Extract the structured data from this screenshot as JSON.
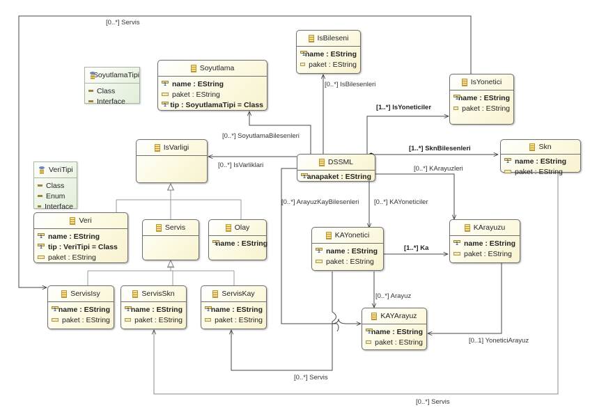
{
  "diagram": {
    "type": "Ecore class diagram",
    "classes": {
      "soyutlama": {
        "name": "Soyutlama",
        "attrs": [
          {
            "text": "name : EString",
            "key": true
          },
          {
            "text": "paket : EString",
            "key": false
          },
          {
            "text": "tip : SoyutlamaTipi = Class",
            "key": true
          }
        ]
      },
      "isbileseni": {
        "name": "IsBileseni",
        "attrs": [
          {
            "text": "name : EString",
            "key": true
          },
          {
            "text": "paket : EString",
            "key": false
          }
        ]
      },
      "isyonetici": {
        "name": "IsYonetici",
        "attrs": [
          {
            "text": "name : EString",
            "key": true
          },
          {
            "text": "paket : EString",
            "key": false
          }
        ]
      },
      "isvarligi": {
        "name": "IsVarligi",
        "attrs": []
      },
      "dssml": {
        "name": "DSSML",
        "attrs": [
          {
            "text": "anapaket : EString",
            "key": true
          }
        ]
      },
      "skn": {
        "name": "Skn",
        "attrs": [
          {
            "text": "name : EString",
            "key": true
          },
          {
            "text": "paket : EString",
            "key": false
          }
        ]
      },
      "veri": {
        "name": "Veri",
        "attrs": [
          {
            "text": "name : EString",
            "key": true
          },
          {
            "text": "tip : VeriTipi = Class",
            "key": true
          },
          {
            "text": "paket : EString",
            "key": false
          }
        ]
      },
      "servis": {
        "name": "Servis",
        "attrs": []
      },
      "olay": {
        "name": "Olay",
        "attrs": [
          {
            "text": "name : EString",
            "key": true
          }
        ]
      },
      "kayonetici": {
        "name": "KAYonetici",
        "attrs": [
          {
            "text": "name : EString",
            "key": true
          },
          {
            "text": "paket : EString",
            "key": false
          }
        ]
      },
      "karayuzu": {
        "name": "KArayuzu",
        "attrs": [
          {
            "text": "name : EString",
            "key": true
          },
          {
            "text": "paket : EString",
            "key": false
          }
        ]
      },
      "servisisy": {
        "name": "ServisIsy",
        "attrs": [
          {
            "text": "name : EString",
            "key": true
          },
          {
            "text": "paket : EString",
            "key": false
          }
        ]
      },
      "servisskn": {
        "name": "ServisSkn",
        "attrs": [
          {
            "text": "name : EString",
            "key": true
          },
          {
            "text": "paket : EString",
            "key": false
          }
        ]
      },
      "serviskay": {
        "name": "ServisKay",
        "attrs": [
          {
            "text": "name : EString",
            "key": true
          },
          {
            "text": "paket : EString",
            "key": false
          }
        ]
      },
      "kayarayuz": {
        "name": "KAYArayuz",
        "attrs": [
          {
            "text": "name : EString",
            "key": true
          },
          {
            "text": "paket : EString",
            "key": false
          }
        ]
      }
    },
    "enums": {
      "soyutlamatipi": {
        "name": "SoyutlamaTipi",
        "literals": [
          "Class",
          "Interface"
        ]
      },
      "veritipi": {
        "name": "VeriTipi",
        "literals": [
          "Class",
          "Enum",
          "Interface"
        ]
      }
    },
    "references": {
      "servis_top": "[0..*] Servis",
      "isbilesenleri": "[0..*] IsBilesenleri",
      "soyutlamabilesenleri": "[0..*] SoyutlamaBilesenleri",
      "isyoneticiler": "[1..*] IsYoneticiler",
      "isvarliklari": "[0..*] IsVarliklari",
      "sknbilesenleri": "[1..*] SknBilesenleri",
      "karayuzleri": "[0..*] KArayuzleri",
      "arayuzkaybilesenleri": "[0..*] ArayuzKayBilesenleri",
      "kayoneticiler": "[0..*] KAYoneticiler",
      "ka": "[1..*] Ka",
      "arayuz": "[0..*] Arayuz",
      "yoneticiarayuz": "[0..1] YoneticiArayuz",
      "servis_kay": "[0..*] Servis",
      "servis_skn": "[0..*] Servis"
    }
  }
}
